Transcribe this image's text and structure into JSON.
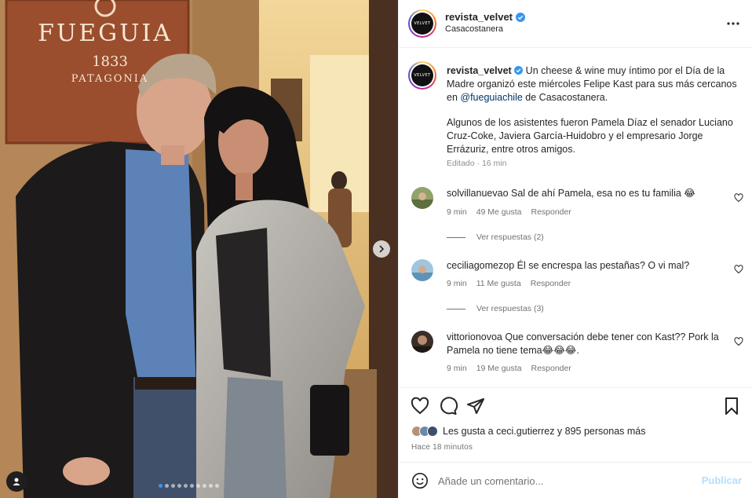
{
  "post": {
    "photo_sign": {
      "brand": "FUEGUIA",
      "year": "1833",
      "region": "PATAGONIA"
    },
    "carousel": {
      "total": 10,
      "current": 1
    }
  },
  "header": {
    "username": "revista_velvet",
    "location": "Casacostanera",
    "avatar_text": "VELVET",
    "more_icon": "more-horizontal-icon"
  },
  "caption": {
    "username": "revista_velvet",
    "text_part1": " Un cheese & wine muy íntimo por el Día de la Madre organizó este miércoles Felipe Kast para sus más cercanos en ",
    "mention": "@fueguiachile",
    "text_part2": " de Casacostanera.",
    "paragraph2": "Algunos de los asistentes fueron Pamela Díaz el senador Luciano Cruz-Coke, Javiera García-Huidobro y el empresario Jorge Errázuriz, entre otros amigos.",
    "edited_label": "Editado · 16 min"
  },
  "comments": [
    {
      "username": "solvillanuevao",
      "text": " Sal de ahí Pamela, esa no es tu familia 😂",
      "time": "9 min",
      "likes": "49 Me gusta",
      "reply": "Responder",
      "view_replies": "Ver respuestas (2)"
    },
    {
      "username": "ceciliagomezop",
      "text": " Él se encrespa las pestañas? O vi mal?",
      "time": "9 min",
      "likes": "11 Me gusta",
      "reply": "Responder",
      "view_replies": "Ver respuestas (3)"
    },
    {
      "username": "vittorionovoa",
      "text": " Que conversación debe tener con Kast?? Pork la Pamela no tiene tema😂😂😂.",
      "time": "9 min",
      "likes": "19 Me gusta",
      "reply": "Responder"
    }
  ],
  "actions": {
    "likes_prefix": "Les gusta a ",
    "likes_user": "ceci.gutierrez",
    "likes_mid": " y ",
    "likes_count": "895 personas más",
    "time_ago": "Hace 18 minutos"
  },
  "add_comment": {
    "placeholder": "Añade un comentario...",
    "publish": "Publicar"
  },
  "colors": {
    "accent_blue": "#3797f0",
    "link": "#00376b",
    "publish_disabled": "#b2dffc"
  }
}
